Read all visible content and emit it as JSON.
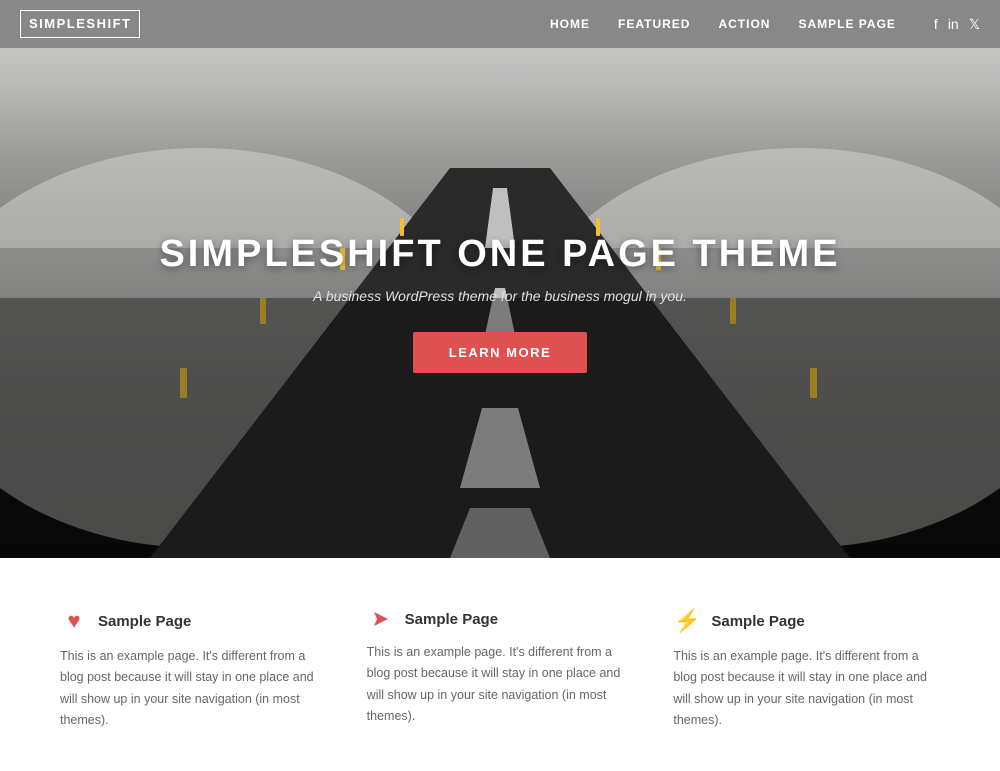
{
  "header": {
    "logo": "SIMPLESHIFT",
    "nav": {
      "items": [
        {
          "label": "HOME",
          "key": "home"
        },
        {
          "label": "FEATURED",
          "key": "featured"
        },
        {
          "label": "ACTION",
          "key": "action"
        },
        {
          "label": "SAMPLE PAGE",
          "key": "sample-page"
        }
      ],
      "social": [
        {
          "icon": "f",
          "label": "Facebook"
        },
        {
          "icon": "in",
          "label": "LinkedIn"
        },
        {
          "icon": "t",
          "label": "Twitter"
        }
      ]
    }
  },
  "hero": {
    "title": "SIMPLESHIFT ONE PAGE THEME",
    "subtitle": "A business WordPress theme for the business mogul in you.",
    "cta_label": "LEARN MORE"
  },
  "features": {
    "items": [
      {
        "icon": "heart",
        "icon_char": "♥",
        "title": "Sample Page",
        "text": "This is an example page. It's different from a blog post because it will stay in one place and will show up in your site navigation (in most themes)."
      },
      {
        "icon": "arrow",
        "icon_char": "➤",
        "title": "Sample Page",
        "text": "This is an example page. It's different from a blog post because it will stay in one place and will show up in your site navigation (in most themes)."
      },
      {
        "icon": "bolt",
        "icon_char": "⚡",
        "title": "Sample Page",
        "text": "This is an example page. It's different from a blog post because it will stay in one place and will show up in your site navigation (in most themes)."
      }
    ]
  }
}
